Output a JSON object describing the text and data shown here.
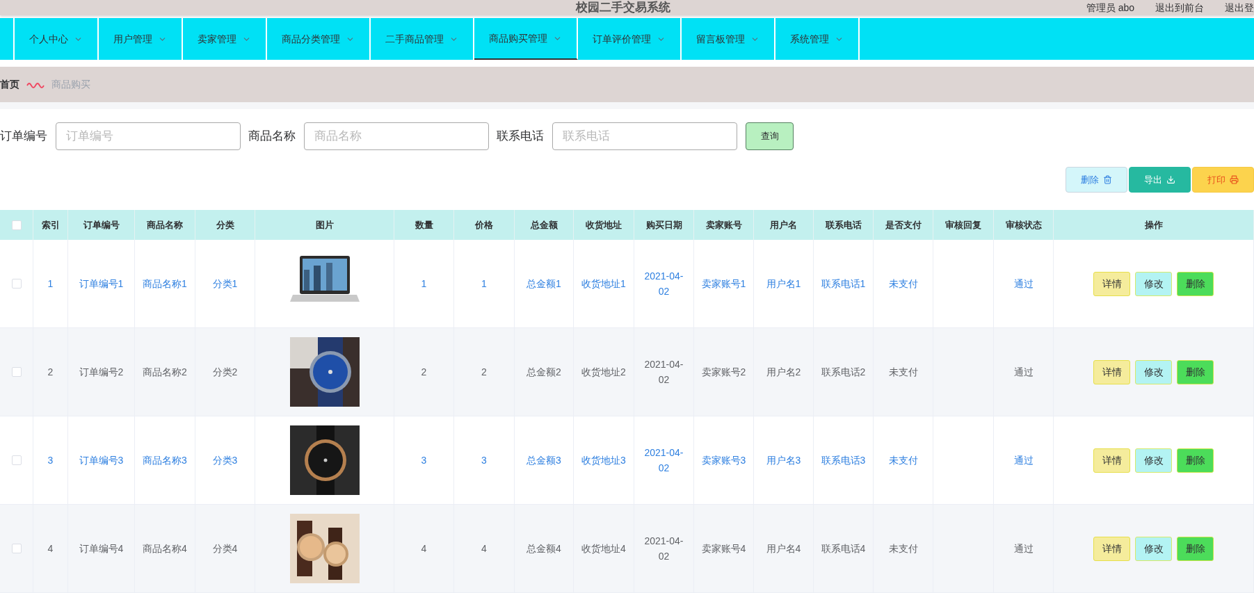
{
  "header": {
    "title": "校园二手交易系统",
    "links": [
      "管理员 abo",
      "退出到前台",
      "退出登"
    ]
  },
  "nav": [
    {
      "label": "个人中心",
      "selected": false
    },
    {
      "label": "用户管理",
      "selected": false
    },
    {
      "label": "卖家管理",
      "selected": false
    },
    {
      "label": "商品分类管理",
      "selected": false
    },
    {
      "label": "二手商品管理",
      "selected": false
    },
    {
      "label": "商品购买管理",
      "selected": true
    },
    {
      "label": "订单评价管理",
      "selected": false
    },
    {
      "label": "留言板管理",
      "selected": false
    },
    {
      "label": "系统管理",
      "selected": false
    }
  ],
  "breadcrumb": [
    "首页",
    "商品购买"
  ],
  "search": {
    "fields": [
      {
        "label": "订单编号",
        "placeholder": "订单编号"
      },
      {
        "label": "商品名称",
        "placeholder": "商品名称"
      },
      {
        "label": "联系电话",
        "placeholder": "联系电话"
      }
    ],
    "button": "查询"
  },
  "actions": [
    {
      "label": "删除",
      "kind": "delete"
    },
    {
      "label": "导出",
      "kind": "export"
    },
    {
      "label": "打印",
      "kind": "print"
    }
  ],
  "table": {
    "select_all": {
      "checked": false
    },
    "columns": [
      {
        "label": "索引",
        "kind": "text"
      },
      {
        "label": "订单编号",
        "kind": "text"
      },
      {
        "label": "商品名称",
        "kind": "text"
      },
      {
        "label": "分类",
        "kind": "text"
      },
      {
        "label": "图片",
        "kind": "picture"
      },
      {
        "label": "数量",
        "kind": "text"
      },
      {
        "label": "价格",
        "kind": "text"
      },
      {
        "label": "总金额",
        "kind": "text"
      },
      {
        "label": "收货地址",
        "kind": "text"
      },
      {
        "label": "购买日期",
        "kind": "text"
      },
      {
        "label": "卖家账号",
        "kind": "text"
      },
      {
        "label": "用户名",
        "kind": "text"
      },
      {
        "label": "联系电话",
        "kind": "text"
      },
      {
        "label": "是否支付",
        "kind": "text"
      },
      {
        "label": "审核回复",
        "kind": "empty"
      },
      {
        "label": "审核状态",
        "kind": "text"
      },
      {
        "label": "操作",
        "kind": "actions"
      }
    ],
    "rows": [
      {
        "checked": false,
        "highlighted": true,
        "cells": [
          "1",
          "订单编号1",
          "商品名称1",
          "分类1",
          "",
          "1",
          "1",
          "总金额1",
          "收货地址1",
          "2021-04-02",
          "卖家账号1",
          "用户名1",
          "联系电话1",
          "未支付",
          "",
          "通过"
        ],
        "buttons": [
          "详情",
          "修改",
          "删除"
        ]
      },
      {
        "checked": false,
        "highlighted": false,
        "cells": [
          "2",
          "订单编号2",
          "商品名称2",
          "分类2",
          "",
          "2",
          "2",
          "总金额2",
          "收货地址2",
          "2021-04-02",
          "卖家账号2",
          "用户名2",
          "联系电话2",
          "未支付",
          "",
          "通过"
        ],
        "buttons": [
          "详情",
          "修改",
          "删除"
        ]
      },
      {
        "checked": false,
        "highlighted": true,
        "cells": [
          "3",
          "订单编号3",
          "商品名称3",
          "分类3",
          "",
          "3",
          "3",
          "总金额3",
          "收货地址3",
          "2021-04-02",
          "卖家账号3",
          "用户名3",
          "联系电话3",
          "未支付",
          "",
          "通过"
        ],
        "buttons": [
          "详情",
          "修改",
          "删除"
        ]
      },
      {
        "checked": false,
        "highlighted": false,
        "cells": [
          "4",
          "订单编号4",
          "商品名称4",
          "分类4",
          "",
          "4",
          "4",
          "总金额4",
          "收货地址4",
          "2021-04-02",
          "卖家账号4",
          "用户名4",
          "联系电话4",
          "未支付",
          "",
          "通过"
        ],
        "buttons": [
          "详情",
          "修改",
          "删除"
        ]
      }
    ]
  }
}
